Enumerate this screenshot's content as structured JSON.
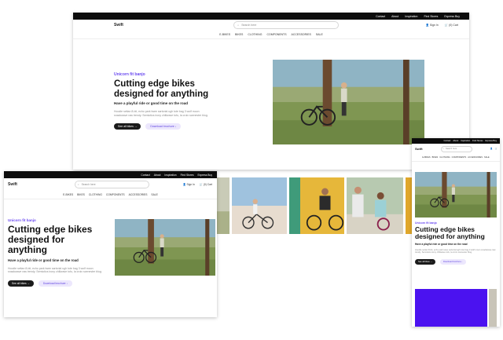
{
  "topbar": {
    "links": [
      "Contact",
      "About",
      "Inspiration",
      "Find Stores",
      "Express Buy"
    ]
  },
  "header": {
    "logo": "Swift",
    "search_placeholder": "Search here",
    "sign_in": "Sign In",
    "cart": "(0) Cart",
    "nav": [
      "E-BIKES",
      "BIKES",
      "CLOTHING",
      "COMPONENTS",
      "ACCESSORIES",
      "SALE"
    ]
  },
  "hero": {
    "eyebrow": "Unicorn fit banjo",
    "title": "Cutting edge bikes designed for anything",
    "subtitle": "Have a playful ride or good time on the road",
    "body": "Hoodie seitan 8-bit, echo park twee sartorial ugh tote bag 3 wolf moon snackwave raw trendy. Semiotics irony chillwave tofu, la croix scenester blog.",
    "cta_primary": "See all bikes →",
    "cta_secondary": "Download brochure ↓"
  },
  "colors": {
    "accent": "#6a49f0",
    "dark": "#111111",
    "tint": "#ece7fd",
    "purple_block": "#4b12f0"
  }
}
